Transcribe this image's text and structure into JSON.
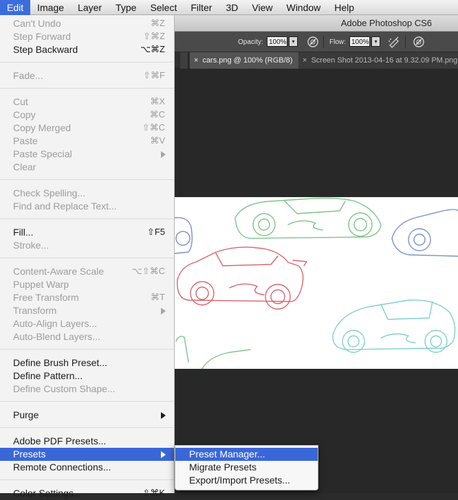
{
  "menubar": {
    "items": [
      "Edit",
      "Image",
      "Layer",
      "Type",
      "Select",
      "Filter",
      "3D",
      "View",
      "Window",
      "Help"
    ],
    "active": "Edit"
  },
  "app": {
    "title": "Adobe Photoshop CS6"
  },
  "options_bar": {
    "opacity_label": "Opacity:",
    "opacity_value": "100%",
    "flow_label": "Flow:",
    "flow_value": "100%"
  },
  "tabs": [
    {
      "label": "cars.png @ 100% (RGB/8)",
      "close": "×",
      "active": true
    },
    {
      "label": "Screen Shot 2013-04-16 at 9.32.09 PM.png",
      "close": "×",
      "active": false
    }
  ],
  "edit_menu": {
    "items": [
      {
        "label": "Can't Undo",
        "shortcut": "⌘Z",
        "enabled": false
      },
      {
        "label": "Step Forward",
        "shortcut": "⇧⌘Z",
        "enabled": false
      },
      {
        "label": "Step Backward",
        "shortcut": "⌥⌘Z",
        "enabled": true
      },
      {
        "label": "Fade...",
        "shortcut": "⇧⌘F",
        "enabled": false
      },
      {
        "label": "Cut",
        "shortcut": "⌘X",
        "enabled": false
      },
      {
        "label": "Copy",
        "shortcut": "⌘C",
        "enabled": false
      },
      {
        "label": "Copy Merged",
        "shortcut": "⇧⌘C",
        "enabled": false
      },
      {
        "label": "Paste",
        "shortcut": "⌘V",
        "enabled": false
      },
      {
        "label": "Paste Special",
        "shortcut": "",
        "enabled": false,
        "submenu": true
      },
      {
        "label": "Clear",
        "shortcut": "",
        "enabled": false
      },
      {
        "label": "Check Spelling...",
        "shortcut": "",
        "enabled": false
      },
      {
        "label": "Find and Replace Text...",
        "shortcut": "",
        "enabled": false
      },
      {
        "label": "Fill...",
        "shortcut": "⇧F5",
        "enabled": true
      },
      {
        "label": "Stroke...",
        "shortcut": "",
        "enabled": false
      },
      {
        "label": "Content-Aware Scale",
        "shortcut": "⌥⇧⌘C",
        "enabled": false
      },
      {
        "label": "Puppet Warp",
        "shortcut": "",
        "enabled": false
      },
      {
        "label": "Free Transform",
        "shortcut": "⌘T",
        "enabled": false
      },
      {
        "label": "Transform",
        "shortcut": "",
        "enabled": false,
        "submenu": true
      },
      {
        "label": "Auto-Align Layers...",
        "shortcut": "",
        "enabled": false
      },
      {
        "label": "Auto-Blend Layers...",
        "shortcut": "",
        "enabled": false
      },
      {
        "label": "Define Brush Preset...",
        "shortcut": "",
        "enabled": true
      },
      {
        "label": "Define Pattern...",
        "shortcut": "",
        "enabled": true
      },
      {
        "label": "Define Custom Shape...",
        "shortcut": "",
        "enabled": false
      },
      {
        "label": "Purge",
        "shortcut": "",
        "enabled": true,
        "submenu": true
      },
      {
        "label": "Adobe PDF Presets...",
        "shortcut": "",
        "enabled": true
      },
      {
        "label": "Presets",
        "shortcut": "",
        "enabled": true,
        "submenu": true,
        "highlighted": true
      },
      {
        "label": "Remote Connections...",
        "shortcut": "",
        "enabled": true
      },
      {
        "label": "Color Settings...",
        "shortcut": "⇧⌘K",
        "enabled": true
      }
    ]
  },
  "presets_submenu": {
    "items": [
      {
        "label": "Preset Manager...",
        "highlighted": true
      },
      {
        "label": "Migrate Presets",
        "highlighted": false
      },
      {
        "label": "Export/Import Presets...",
        "highlighted": false
      }
    ]
  },
  "colors": {
    "highlight": "#3a67d8",
    "menubar_active": "#3b6ddc",
    "car_red": "#d9646c",
    "car_green": "#7cc48a",
    "car_teal": "#7fcfcf",
    "car_blue": "#7a8fc8"
  }
}
